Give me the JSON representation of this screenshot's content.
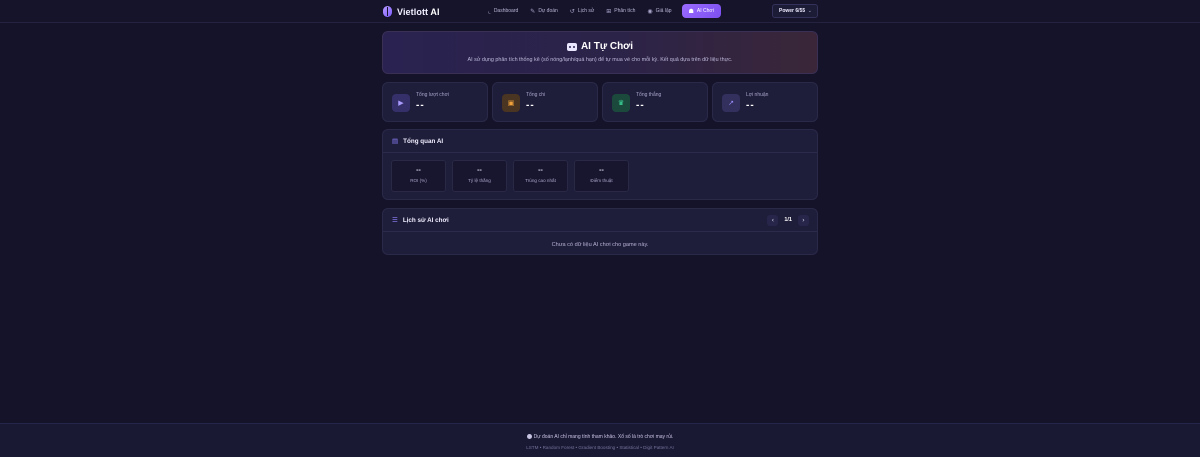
{
  "brand": {
    "name": "Vietlott",
    "suffix": "AI"
  },
  "nav": {
    "items": [
      {
        "label": "Dashboard",
        "icon": "chart-icon"
      },
      {
        "label": "Dự đoán",
        "icon": "pencil-icon"
      },
      {
        "label": "Lịch sử",
        "icon": "history-icon"
      },
      {
        "label": "Phân tích",
        "icon": "analytics-icon"
      },
      {
        "label": "Giả lập",
        "icon": "eye-icon"
      }
    ],
    "active": {
      "label": "AI Chơi",
      "icon": "robot-icon"
    }
  },
  "game_select": {
    "value": "Power 6/55"
  },
  "hero": {
    "title": "AI Tự Chơi",
    "subtitle": "AI sử dụng phân tích thống kê (số nóng/lạnh/quá hạn) để tự mua vé cho mỗi kỳ. Kết quả dựa trên dữ liệu thực."
  },
  "stats": [
    {
      "label": "Tổng lượt chơi",
      "value": "--",
      "icon": "play-icon",
      "accent": "#a99bff"
    },
    {
      "label": "Tổng chi",
      "value": "--",
      "icon": "ticket-icon",
      "accent": "#f2a23a"
    },
    {
      "label": "Tổng thắng",
      "value": "--",
      "icon": "trophy-icon",
      "accent": "#3ee0a0"
    },
    {
      "label": "Lợi nhuận",
      "value": "--",
      "icon": "trend-icon",
      "accent": "#9a8dff"
    }
  ],
  "overview": {
    "title": "Tổng quan AI",
    "metrics": [
      {
        "value": "--",
        "label": "ROI (%)"
      },
      {
        "value": "--",
        "label": "Tỷ lệ thắng"
      },
      {
        "value": "--",
        "label": "Trúng cao nhất"
      },
      {
        "value": "--",
        "label": "Điểm thuật"
      }
    ]
  },
  "history": {
    "title": "Lịch sử AI chơi",
    "page": "1/1",
    "empty": "Chưa có dữ liệu AI chơi cho game này."
  },
  "footer": {
    "disclaimer": "Dự đoán AI chỉ mang tính tham khảo. Xổ số là trò chơi may rủi.",
    "models": "LSTM • Random Forest • Gradient Boosting • Statistical • Digit Pattern AI"
  },
  "colors": {
    "accent": "#7b4ff0",
    "background": "#14132a",
    "card": "#1e1d3a"
  }
}
